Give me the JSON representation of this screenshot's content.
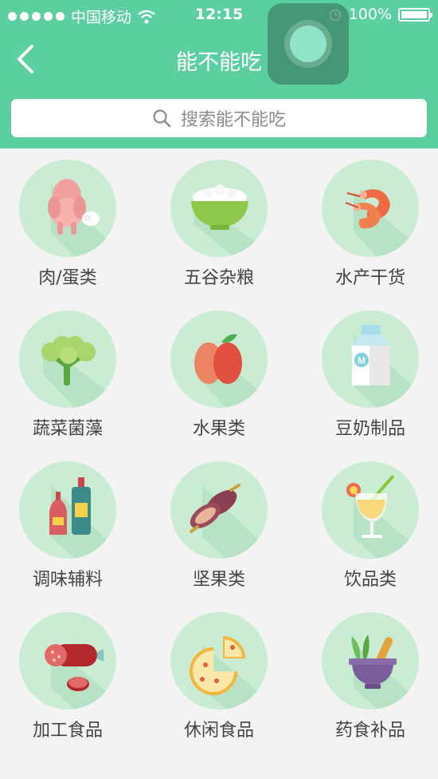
{
  "status_bar": {
    "carrier": "中国移动",
    "time": "12:15",
    "battery": "100%"
  },
  "nav": {
    "title": "能不能吃",
    "back_icon": "chevron-left-icon"
  },
  "search": {
    "placeholder": "搜索能不能吃",
    "icon": "search-icon"
  },
  "categories": [
    {
      "label": "肉/蛋类",
      "icon": "chicken-egg-icon"
    },
    {
      "label": "五谷杂粮",
      "icon": "rice-bowl-icon"
    },
    {
      "label": "水产干货",
      "icon": "shrimp-icon"
    },
    {
      "label": "蔬菜菌藻",
      "icon": "broccoli-icon"
    },
    {
      "label": "水果类",
      "icon": "apple-icon"
    },
    {
      "label": "豆奶制品",
      "icon": "milk-carton-icon"
    },
    {
      "label": "调味辅料",
      "icon": "sauce-bottles-icon"
    },
    {
      "label": "坚果类",
      "icon": "nuts-icon"
    },
    {
      "label": "饮品类",
      "icon": "cocktail-icon"
    },
    {
      "label": "加工食品",
      "icon": "sausage-icon"
    },
    {
      "label": "休闲食品",
      "icon": "pizza-icon"
    },
    {
      "label": "药食补品",
      "icon": "mortar-herbs-icon"
    }
  ],
  "colors": {
    "header": "#5ccfa1",
    "circle": "#c9ecd3",
    "background": "#f3f3f3"
  }
}
